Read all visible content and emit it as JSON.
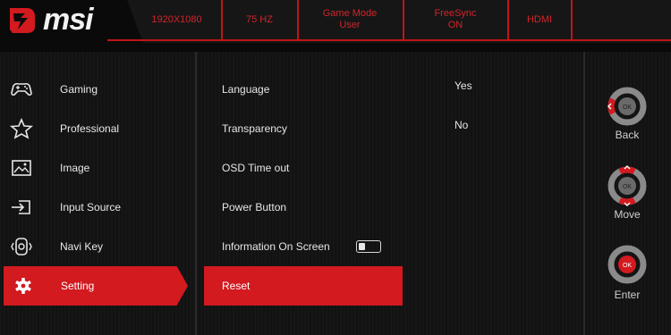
{
  "brand": {
    "name": "msi"
  },
  "header": {
    "items": [
      {
        "line1": "1920X1080",
        "line2": ""
      },
      {
        "line1": "75 HZ",
        "line2": ""
      },
      {
        "line1": "Game Mode",
        "line2": "User"
      },
      {
        "line1": "FreeSync",
        "line2": "ON"
      },
      {
        "line1": "HDMI",
        "line2": ""
      }
    ]
  },
  "menu": {
    "items": [
      {
        "label": "Gaming",
        "icon": "gamepad-icon"
      },
      {
        "label": "Professional",
        "icon": "star-icon"
      },
      {
        "label": "Image",
        "icon": "image-icon"
      },
      {
        "label": "Input Source",
        "icon": "input-source-icon"
      },
      {
        "label": "Navi Key",
        "icon": "navi-key-icon"
      },
      {
        "label": "Setting",
        "icon": "gear-icon",
        "active": true
      }
    ]
  },
  "settings": {
    "items": [
      {
        "label": "Language",
        "value": "Yes"
      },
      {
        "label": "Transparency",
        "value": "No"
      },
      {
        "label": "OSD Time out"
      },
      {
        "label": "Power Button"
      },
      {
        "label": "Information On Screen",
        "toggle": "off"
      },
      {
        "label": "Reset",
        "active": true
      }
    ]
  },
  "controls": {
    "back": {
      "label": "Back",
      "key": "OK"
    },
    "move": {
      "label": "Move",
      "key": "OK"
    },
    "enter": {
      "label": "Enter",
      "key": "OK"
    }
  },
  "colors": {
    "accent": "#d21a1f",
    "text": "#e6e6e6",
    "bg": "#141415"
  }
}
